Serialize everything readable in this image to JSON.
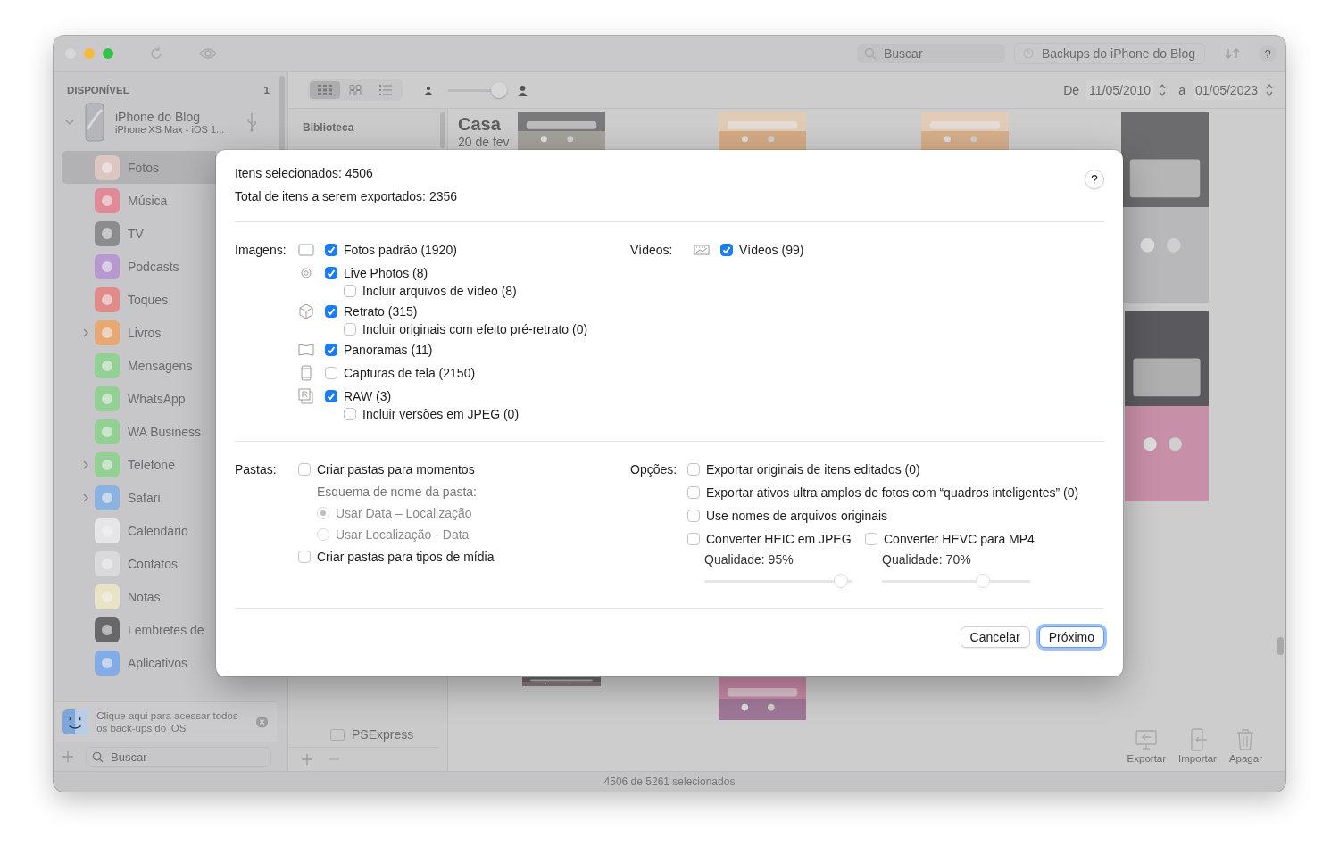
{
  "toolbar": {
    "search": {
      "placeholder": "Buscar"
    },
    "backups": {
      "placeholder": "Backups do iPhone do Blog"
    },
    "help": "?"
  },
  "sidebar": {
    "section": "DISPONÍVEL",
    "count": "1",
    "device": {
      "name": "iPhone do Blog",
      "model": "iPhone XS Max - iOS 1...",
      "expanded": true
    },
    "apps": [
      {
        "label": "Fotos",
        "selected": true,
        "expandable": false,
        "color": "#dcc6c2"
      },
      {
        "label": "Música",
        "selected": false,
        "expandable": false,
        "color": "#e08a98"
      },
      {
        "label": "TV",
        "selected": false,
        "expandable": false,
        "color": "#8c8c8e"
      },
      {
        "label": "Podcasts",
        "selected": false,
        "expandable": false,
        "color": "#b898d0"
      },
      {
        "label": "Toques",
        "selected": false,
        "expandable": false,
        "color": "#e08a8a"
      },
      {
        "label": "Livros",
        "selected": false,
        "expandable": true,
        "color": "#e8a872"
      },
      {
        "label": "Mensagens",
        "selected": false,
        "expandable": false,
        "color": "#92d094"
      },
      {
        "label": "WhatsApp",
        "selected": false,
        "expandable": false,
        "color": "#92d094"
      },
      {
        "label": "WA Business",
        "selected": false,
        "expandable": false,
        "color": "#92d094"
      },
      {
        "label": "Telefone",
        "selected": false,
        "expandable": true,
        "color": "#92d094"
      },
      {
        "label": "Safari",
        "selected": false,
        "expandable": true,
        "color": "#8cb2e2"
      },
      {
        "label": "Calendário",
        "selected": false,
        "expandable": false,
        "color": "#e6e6e8"
      },
      {
        "label": "Contatos",
        "selected": false,
        "expandable": false,
        "color": "#dadadc"
      },
      {
        "label": "Notas",
        "selected": false,
        "expandable": false,
        "color": "#e8e2c6"
      },
      {
        "label": "Lembretes de",
        "selected": false,
        "expandable": false,
        "color": "#68686a"
      },
      {
        "label": "Aplicativos",
        "selected": false,
        "expandable": false,
        "color": "#82ace8"
      }
    ],
    "tip": "Clique aqui para acessar todos os back-ups do iOS",
    "search": {
      "placeholder": "Buscar"
    }
  },
  "main": {
    "views": [
      {
        "kind": "grid",
        "selected": true
      },
      {
        "kind": "tiles",
        "selected": false
      },
      {
        "kind": "list",
        "selected": false
      }
    ],
    "zoom": {
      "level": 0.85
    },
    "date_from_label": "De",
    "date_from": "11/05/2010",
    "date_to_label": "a",
    "date_to": "01/05/2023",
    "library_heading": "Biblioteca",
    "album": "PSExpress",
    "moment_title": "Casa",
    "moment_date": "20 de fev",
    "actions": [
      "Exportar",
      "Importar",
      "Apagar"
    ]
  },
  "status_bar": "4506 de 5261 selecionados",
  "dialog": {
    "selected_count": "Itens selecionados: 4506",
    "export_total": "Total de itens a serem exportados: 2356",
    "help": "?",
    "images_label": "Imagens:",
    "images": [
      {
        "kind": "standard",
        "label": "Fotos padrão (1920)",
        "checked": true
      },
      {
        "kind": "live",
        "label": "Live Photos (8)",
        "checked": true,
        "sub": {
          "label": "Incluir arquivos de vídeo (8)",
          "checked": false
        }
      },
      {
        "kind": "portrait",
        "label": "Retrato (315)",
        "checked": true,
        "sub": {
          "label": "Incluir originais com efeito pré-retrato (0)",
          "checked": false
        }
      },
      {
        "kind": "panorama",
        "label": "Panoramas (11)",
        "checked": true
      },
      {
        "kind": "screenshot",
        "label": "Capturas de tela (2150)",
        "checked": false
      },
      {
        "kind": "raw",
        "label": "RAW (3)",
        "checked": true,
        "sub": {
          "label": "Incluir versões em JPEG (0)",
          "checked": false
        }
      }
    ],
    "videos_label": "Vídeos:",
    "videos": {
      "label": "Vídeos (99)",
      "checked": true
    },
    "folders_label": "Pastas:",
    "moments": {
      "label": "Criar pastas para momentos",
      "checked": false
    },
    "scheme_label": "Esquema de nome da pasta:",
    "schemes": [
      {
        "label": "Usar Data – Localização",
        "selected": true,
        "disabled": true
      },
      {
        "label": "Usar Localização - Data",
        "selected": false,
        "disabled": true
      }
    ],
    "media_types": {
      "label": "Criar pastas para tipos de mídia",
      "checked": false
    },
    "options_label": "Opções:",
    "options": [
      {
        "label": "Exportar originais de itens editados (0)",
        "checked": false
      },
      {
        "label": "Exportar ativos ultra amplos de fotos com “quadros inteligentes” (0)",
        "checked": false
      },
      {
        "label": "Use nomes de arquivos originais",
        "checked": false
      }
    ],
    "conversions": [
      {
        "label": "Converter HEIC em JPEG",
        "checked": false,
        "quality": "Qualidade: 95%",
        "level": 0.92
      },
      {
        "label": "Converter HEVC para MP4",
        "checked": false,
        "quality": "Qualidade: 70%",
        "level": 0.68
      }
    ],
    "buttons": [
      {
        "label": "Cancelar",
        "kind": "normal"
      },
      {
        "label": "Próximo",
        "kind": "default"
      }
    ]
  }
}
